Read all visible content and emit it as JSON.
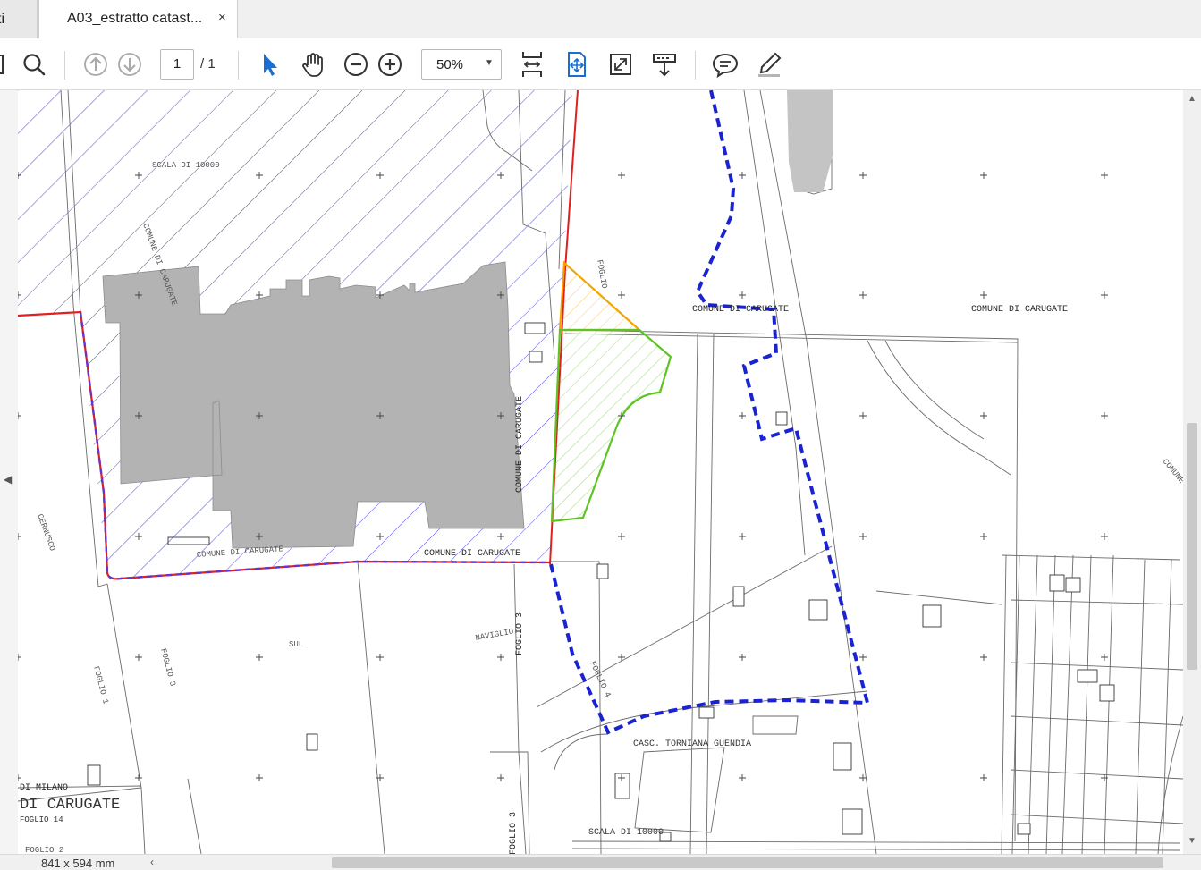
{
  "tabs": [
    {
      "label": "ti"
    },
    {
      "label": "A03_estratto catast...",
      "close_glyph": "×"
    }
  ],
  "toolbar": {
    "page_current": "1",
    "page_total": "/ 1",
    "zoom": "50%",
    "icons": [
      "panel-icon",
      "search-icon",
      "page-up-icon",
      "page-down-icon",
      "select-arrow-icon",
      "hand-tool-icon",
      "zoom-out-icon",
      "zoom-in-icon",
      "fit-width-icon",
      "fit-page-icon",
      "fullscreen-icon",
      "read-mode-icon",
      "comment-icon",
      "highlight-pen-icon"
    ]
  },
  "map_labels": {
    "scala_top": "SCALA DI 10000",
    "comune_carugate_vert": "COMUNE DI CARUGATE",
    "comune_top_mid": "COMUNE DI CARUGATE",
    "comune_top_right": "COMUNE DI CARUGATE",
    "comune_vert_center": "COMUNE DI CARUGATE",
    "comune_bottom_mid": "COMUNE DI CARUGATE",
    "comune_bottom_left": "COMUNE DI CARUGATE",
    "comune_far_right": "COMUNE",
    "foglio_1": "FOGLIO 1",
    "foglio_2": "FOGLIO 2",
    "foglio_3a": "FOGLIO 3",
    "foglio_3b": "FOGLIO 3",
    "foglio_3c": "FOGLIO 3",
    "foglio_4": "FOGLIO 4",
    "foglio_top": "FOGLIO",
    "naviglio": "NAVIGLIO",
    "sul": "SUL",
    "cernusco": "CERNUSCO",
    "di_milano": "DI MILANO",
    "di_carugate_big": "DI CARUGATE",
    "foglio_14": "FOGLIO 14",
    "cascina": "CASC. TORNIANA GUENDIA",
    "scala_bottom": "SCALA DI 10000"
  },
  "status": {
    "page_size": "841 x 594 mm"
  },
  "colors": {
    "hatch_blue": "#3a3ad6",
    "building_gray": "#b3b3b3",
    "boundary_red": "#e02020",
    "boundary_blue_dash": "#1a23d0",
    "area_orange": "#f2a400",
    "area_green": "#5ec423"
  }
}
